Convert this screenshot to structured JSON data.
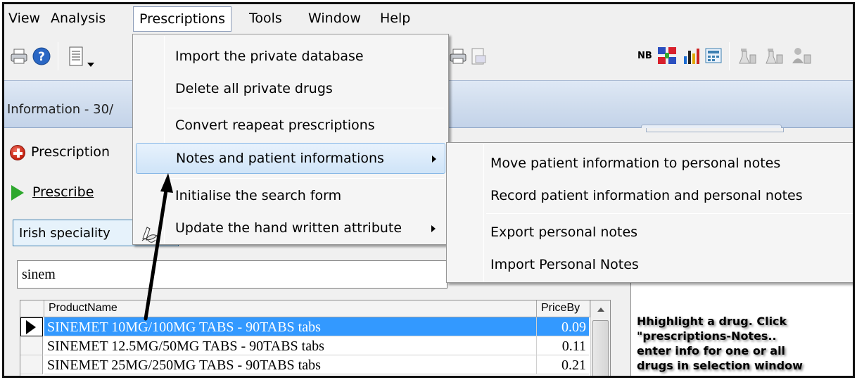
{
  "menubar": {
    "items": [
      "View",
      "Analysis",
      "Prescriptions",
      "Tools",
      "Window",
      "Help"
    ],
    "active": "Prescriptions"
  },
  "toolbar": {
    "left_icons": [
      "printer-icon",
      "help-icon",
      "document-icon",
      "dropdown-arrow-icon"
    ],
    "mid_icons": [
      "printer-icon",
      "preview-icon"
    ],
    "right_icons": [
      "nb-icon",
      "cross-grid-icon",
      "bar-chart-icon",
      "calculator-icon",
      "flask-icon",
      "flask-icon",
      "flask-person-icon"
    ],
    "nb_label": "NB"
  },
  "window": {
    "title": "Information - 30/"
  },
  "prescription_panel": {
    "header": "Prescription",
    "prescribe_label": "Prescribe",
    "speciality_select": "Irish speciality",
    "search_value": "sinem"
  },
  "grid": {
    "columns": [
      "ProductName",
      "PriceBy"
    ],
    "rows": [
      {
        "name": "SINEMET 10MG/100MG TABS - 90TABS tabs",
        "price": "0.09",
        "selected": true
      },
      {
        "name": "SINEMET 12.5MG/50MG TABS - 90TABS tabs",
        "price": "0.11",
        "selected": false
      },
      {
        "name": "SINEMET 25MG/250MG TABS - 90TABS tabs",
        "price": "0.21",
        "selected": false
      }
    ]
  },
  "prescriptions_menu": {
    "items": [
      {
        "label": "Import the private database",
        "has_submenu": false
      },
      {
        "label": "Delete all private drugs",
        "has_submenu": false
      },
      {
        "label": "Convert reapeat prescriptions",
        "has_submenu": false
      },
      {
        "label": "Notes and patient informations",
        "has_submenu": true,
        "highlighted": true
      },
      {
        "label": "Initialise the search form",
        "has_submenu": false
      },
      {
        "label": "Update the hand written attribute",
        "has_submenu": true
      }
    ]
  },
  "notes_submenu": {
    "items": [
      "Move patient information to personal notes",
      "Record patient information and personal notes",
      "Export personal notes",
      "Import Personal Notes"
    ]
  },
  "annotation": {
    "text_lines": [
      "Hhighlight a drug. Click",
      "\"prescriptions-Notes..",
      "enter info for one or all",
      "drugs in selection window"
    ]
  },
  "colors": {
    "selection": "#3399ff",
    "menu_highlight": "#cfe4f8",
    "title_strip": "#cfdced"
  }
}
